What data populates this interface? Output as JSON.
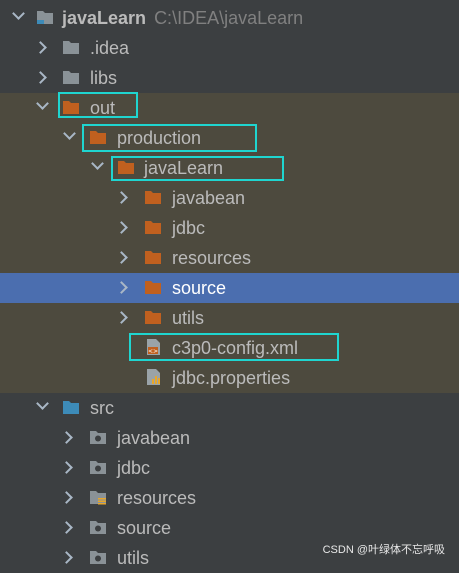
{
  "colors": {
    "background": "#3c3f41",
    "excluded_row": "#4d4a3e",
    "selected_row": "#4b6eaf",
    "highlight_box": "#1fd5d0",
    "folder_gray": "#8a9297",
    "folder_orange": "#c0601f",
    "folder_blue": "#3d8bb8"
  },
  "project": {
    "name": "javaLearn",
    "path": "C:\\IDEA\\javaLearn"
  },
  "tree": [
    {
      "label": ".idea",
      "icon": "folder-icon",
      "chevron": "right"
    },
    {
      "label": "libs",
      "icon": "folder-icon",
      "chevron": "right"
    },
    {
      "label": "out",
      "icon": "excluded-folder-icon",
      "chevron": "down",
      "highlighted": true
    },
    {
      "label": "production",
      "icon": "excluded-folder-icon",
      "chevron": "down",
      "highlighted": true
    },
    {
      "label": "javaLearn",
      "icon": "excluded-folder-icon",
      "chevron": "down",
      "highlighted": true
    },
    {
      "label": "javabean",
      "icon": "excluded-folder-icon",
      "chevron": "right"
    },
    {
      "label": "jdbc",
      "icon": "excluded-folder-icon",
      "chevron": "right"
    },
    {
      "label": "resources",
      "icon": "excluded-folder-icon",
      "chevron": "right"
    },
    {
      "label": "source",
      "icon": "excluded-folder-icon",
      "chevron": "right",
      "selected": true
    },
    {
      "label": "utils",
      "icon": "excluded-folder-icon",
      "chevron": "right"
    },
    {
      "label": "c3p0-config.xml",
      "icon": "xml-file-icon",
      "highlighted": true
    },
    {
      "label": "jdbc.properties",
      "icon": "properties-file-icon"
    },
    {
      "label": "src",
      "icon": "source-folder-icon",
      "chevron": "down"
    },
    {
      "label": "javabean",
      "icon": "package-icon",
      "chevron": "right"
    },
    {
      "label": "jdbc",
      "icon": "package-icon",
      "chevron": "right"
    },
    {
      "label": "resources",
      "icon": "resources-package-icon",
      "chevron": "right"
    },
    {
      "label": "source",
      "icon": "package-icon",
      "chevron": "right"
    },
    {
      "label": "utils",
      "icon": "package-icon",
      "chevron": "right"
    }
  ],
  "watermark": "CSDN @叶绿体不忘呼吸"
}
